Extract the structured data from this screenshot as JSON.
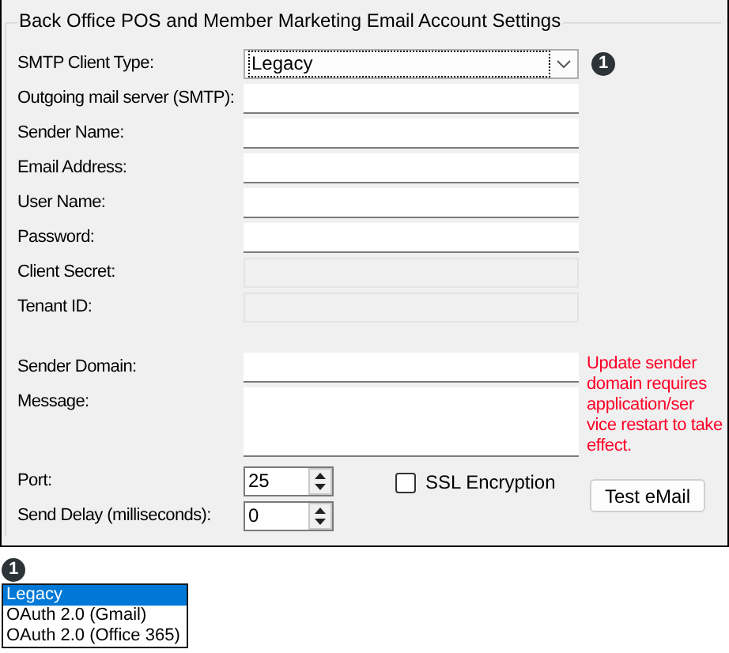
{
  "group_title": "Back Office POS and Member Marketing Email Account Settings",
  "fields": [
    {
      "kind": "combo",
      "label": "SMTP Client Type:",
      "value": "Legacy",
      "callout": "1"
    },
    {
      "kind": "text",
      "label": "Outgoing mail server (SMTP):"
    },
    {
      "kind": "text",
      "label": "Sender Name:"
    },
    {
      "kind": "text",
      "label": "Email Address:"
    },
    {
      "kind": "text",
      "label": "User Name:"
    },
    {
      "kind": "text",
      "label": "Password:"
    },
    {
      "kind": "disabled",
      "label": "Client Secret:"
    },
    {
      "kind": "disabled",
      "label": "Tenant ID:"
    },
    {
      "kind": "text",
      "label": "Sender Domain:",
      "note": "Update sender domain requires application/ser vice restart to take effect."
    },
    {
      "kind": "multiline",
      "label": "Message:"
    },
    {
      "kind": "spinner",
      "label": "Port:",
      "value": "25"
    },
    {
      "kind": "spinner",
      "label": "Send Delay (milliseconds):",
      "value": "0"
    }
  ],
  "ssl_checkbox": {
    "label": "SSL Encryption",
    "checked": false
  },
  "test_button": "Test eMail",
  "dropdown_callout": "1",
  "dropdown_options": [
    {
      "label": "Legacy",
      "selected": true
    },
    {
      "label": "OAuth 2.0 (Gmail)",
      "selected": false
    },
    {
      "label": "OAuth 2.0 (Office 365)",
      "selected": false
    }
  ]
}
